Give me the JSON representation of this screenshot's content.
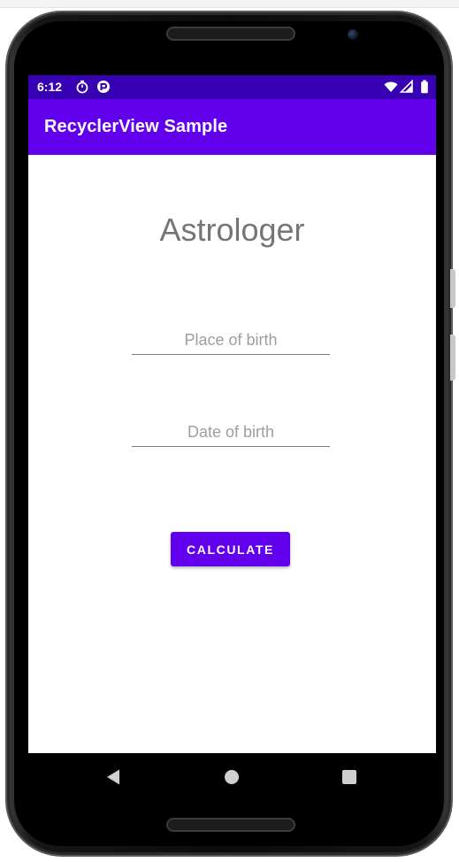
{
  "status_bar": {
    "time": "6:12",
    "left_icons": [
      "timer-icon",
      "app-notification-icon"
    ],
    "right_icons": [
      "wifi-icon",
      "signal-icon",
      "battery-icon"
    ]
  },
  "app_bar": {
    "title": "RecyclerView Sample"
  },
  "main": {
    "heading": "Astrologer",
    "place_of_birth": {
      "placeholder": "Place of birth",
      "value": ""
    },
    "date_of_birth": {
      "placeholder": "Date of birth",
      "value": ""
    },
    "calculate_button": "CALCULATE"
  },
  "nav_bar": {
    "buttons": [
      "back-icon",
      "home-icon",
      "recents-icon"
    ]
  },
  "colors": {
    "primary": "#6200ee",
    "primary_dark": "#3700b3",
    "heading_text": "#757575",
    "hint_text": "#9e9e9e",
    "background": "#ffffff"
  }
}
